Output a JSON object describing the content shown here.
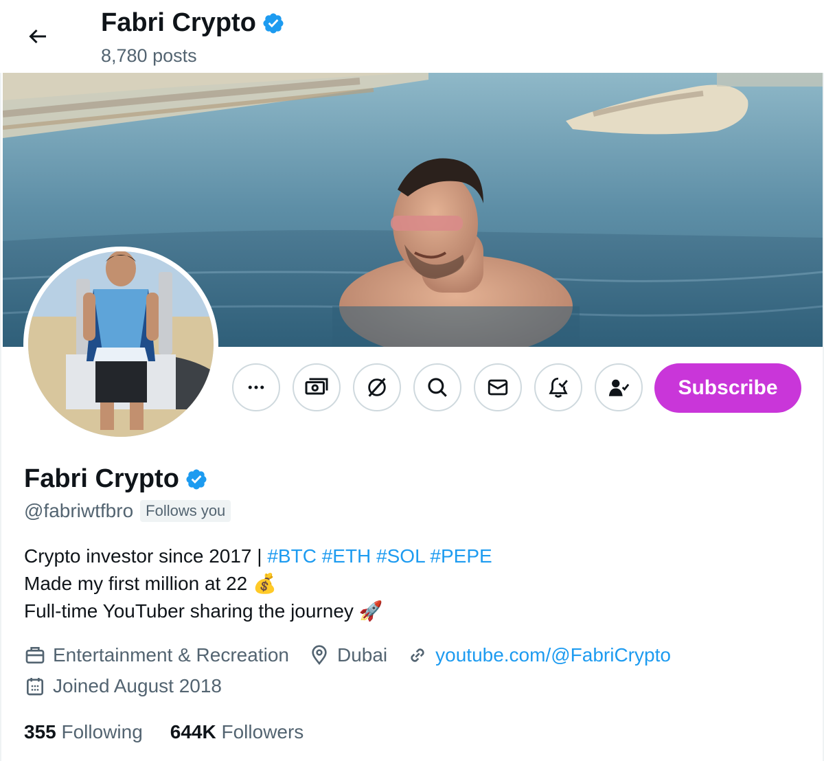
{
  "header": {
    "name": "Fabri Crypto",
    "posts": "8,780 posts"
  },
  "profile": {
    "name": "Fabri Crypto",
    "handle": "@fabriwtfbro",
    "follows_you": "Follows you",
    "bio": {
      "line1_text": "Crypto investor since 2017 | ",
      "hashtags": [
        "#BTC",
        "#ETH",
        "#SOL",
        "#PEPE"
      ],
      "line2_text": "Made my first million at 22",
      "line2_emoji": "💰",
      "line3_text": "Full-time YouTuber sharing the journey",
      "line3_emoji": "🚀"
    },
    "category": "Entertainment & Recreation",
    "location": "Dubai",
    "website": "youtube.com/@FabriCrypto",
    "joined": "Joined August 2018",
    "following_count": "355",
    "following_label": "Following",
    "followers_count": "644K",
    "followers_label": "Followers"
  },
  "actions": {
    "subscribe_label": "Subscribe",
    "more_icon": "more-icon",
    "tip_icon": "money-icon",
    "grok_icon": "grok-icon",
    "search_icon": "search-icon",
    "message_icon": "envelope-icon",
    "notify_icon": "bell-check-icon",
    "following_icon": "person-check-icon"
  },
  "colors": {
    "accent": "#1d9bf0",
    "subscribe": "#c936d9",
    "verified": "#1d9bf0",
    "secondary_text": "#536471"
  }
}
